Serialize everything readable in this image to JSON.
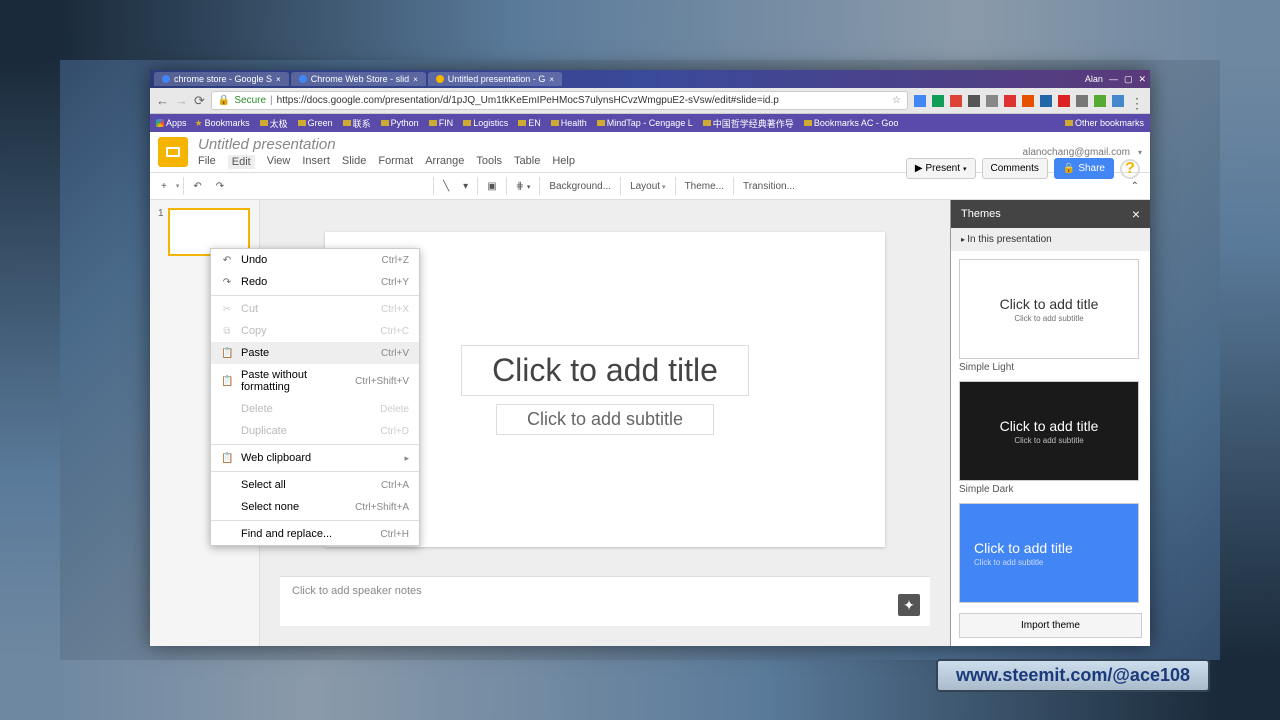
{
  "titlebar": {
    "tabs": [
      {
        "label": "chrome store - Google S",
        "favicon": "#4285f4"
      },
      {
        "label": "Chrome Web Store - slid",
        "favicon": "#4285f4"
      },
      {
        "label": "Untitled presentation - G",
        "favicon": "#f4b400"
      }
    ],
    "user": "Alan"
  },
  "addrbar": {
    "secure": "Secure",
    "url": "https://docs.google.com/presentation/d/1pJQ_Um1tkKeEmIPeHMocS7ulynsHCvzWmgpuE2-sVsw/edit#slide=id.p"
  },
  "bookmarks": {
    "apps": "Apps",
    "items": [
      "Bookmarks",
      "太极",
      "Green",
      "联系",
      "Python",
      "FIN",
      "Logistics",
      "EN",
      "Health",
      "MindTap - Cengage L",
      "中国哲学经典著作导",
      "Bookmarks AC - Goo"
    ],
    "other": "Other bookmarks"
  },
  "app": {
    "title": "Untitled presentation",
    "email": "alanochang@gmail.com",
    "menus": [
      "File",
      "Edit",
      "View",
      "Insert",
      "Slide",
      "Format",
      "Arrange",
      "Tools",
      "Table",
      "Help"
    ],
    "present": "Present",
    "comments": "Comments",
    "share": "Share"
  },
  "toolbar": {
    "new": "+",
    "bg": "Background...",
    "layout": "Layout",
    "theme": "Theme...",
    "transition": "Transition..."
  },
  "edit_menu": [
    {
      "icon": "↶",
      "label": "Undo",
      "shortcut": "Ctrl+Z",
      "enabled": true
    },
    {
      "icon": "↷",
      "label": "Redo",
      "shortcut": "Ctrl+Y",
      "enabled": true
    },
    {
      "sep": true
    },
    {
      "icon": "✂",
      "label": "Cut",
      "shortcut": "Ctrl+X",
      "enabled": false
    },
    {
      "icon": "⧉",
      "label": "Copy",
      "shortcut": "Ctrl+C",
      "enabled": false
    },
    {
      "icon": "📋",
      "label": "Paste",
      "shortcut": "Ctrl+V",
      "enabled": true,
      "hover": true
    },
    {
      "icon": "📋",
      "label": "Paste without formatting",
      "shortcut": "Ctrl+Shift+V",
      "enabled": true
    },
    {
      "icon": "",
      "label": "Delete",
      "shortcut": "Delete",
      "enabled": false
    },
    {
      "icon": "",
      "label": "Duplicate",
      "shortcut": "Ctrl+D",
      "enabled": false
    },
    {
      "sep": true
    },
    {
      "icon": "📋",
      "label": "Web clipboard",
      "submenu": true,
      "enabled": true
    },
    {
      "sep": true
    },
    {
      "icon": "",
      "label": "Select all",
      "shortcut": "Ctrl+A",
      "enabled": true
    },
    {
      "icon": "",
      "label": "Select none",
      "shortcut": "Ctrl+Shift+A",
      "enabled": true
    },
    {
      "sep": true
    },
    {
      "icon": "",
      "label": "Find and replace...",
      "shortcut": "Ctrl+H",
      "enabled": true
    }
  ],
  "slide": {
    "num": "1",
    "title_ph": "Click to add title",
    "sub_ph": "Click to add subtitle",
    "notes_ph": "Click to add speaker notes"
  },
  "themes": {
    "header": "Themes",
    "subheader": "In this presentation",
    "items": [
      {
        "name": "Simple Light",
        "class": "light",
        "title": "Click to add title",
        "sub": "Click to add subtitle"
      },
      {
        "name": "Simple Dark",
        "class": "dark",
        "title": "Click to add title",
        "sub": "Click to add subtitle"
      },
      {
        "name": "",
        "class": "blue",
        "title": "Click to add title",
        "sub": "Click to add subtitle"
      }
    ],
    "import": "Import theme"
  },
  "watermark": "www.steemit.com/@ace108"
}
